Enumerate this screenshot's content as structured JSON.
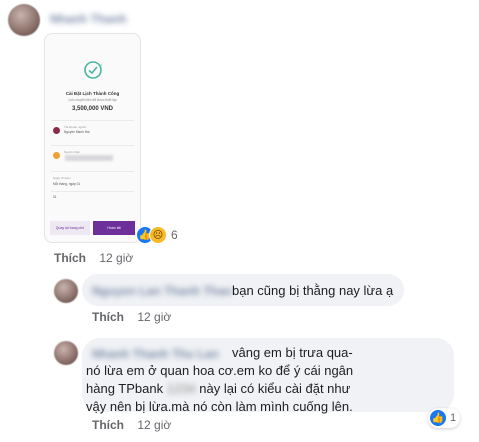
{
  "post": {
    "author_name": "Nhanh Thanh",
    "transfer_screenshot": {
      "status": "Cài Đặt Lịch Thành Công",
      "note": "Lịch chuyển tiền đã được thiết lập",
      "amount": "3,500,000 VND",
      "sender_label": "Tài khoản nguồn",
      "sender_name": "Nguyen Manh Hai",
      "receiver_label": "Người nhận",
      "schedule_label": "Ngày chuyển",
      "schedule_value": "Mỗi tháng, ngày 01",
      "count": "01",
      "btn_left": "Quay lại trang chủ",
      "btn_right": "Hoàn tất",
      "accent_color": "#6d2f9a"
    },
    "reaction_count": "6",
    "like_label": "Thích",
    "time": "12 giờ"
  },
  "comments": [
    {
      "author_name": "Nguyen Lan Thanh Thao",
      "text": "bạn cũng bị thằng nay lừa ạ",
      "like_label": "Thích",
      "time": "12 giờ"
    },
    {
      "author_name": "Nhanh Thanh Thu Lan",
      "text": "vâng em bị trưa qua-nó lừa em ở quan hoa cơ.em ko để ý cái ngân hàng TPbank",
      "text_redacted": "1234",
      "text_after": "này lại có kiểu cài đặt như vậy nên bị lừa.mà nó còn làm mình cuống lên.",
      "reaction_count": "1",
      "like_label": "Thích",
      "time": "12 giờ"
    }
  ],
  "colors": {
    "link_blue": "#1877f2",
    "bubble_gray": "#f0f2f5",
    "meta_gray": "#65676b"
  }
}
